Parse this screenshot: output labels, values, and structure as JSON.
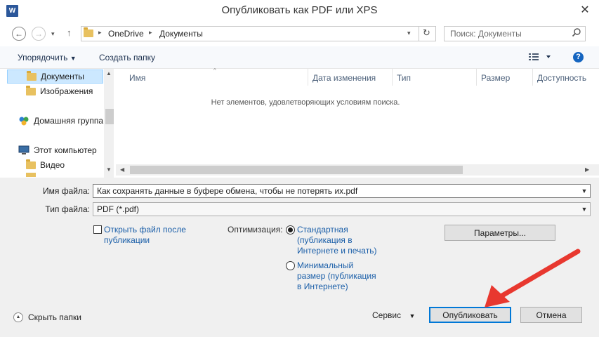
{
  "window": {
    "title": "Опубликовать как PDF или XPS",
    "app_icon_letter": "W",
    "close_symbol": "✕"
  },
  "address": {
    "path_root": "OneDrive",
    "path_folder": "Документы",
    "separator": "▸"
  },
  "search": {
    "placeholder": "Поиск: Документы"
  },
  "toolbar": {
    "organize_label": "Упорядочить",
    "new_folder_label": "Создать папку",
    "help_symbol": "?"
  },
  "sidebar": {
    "items": [
      {
        "label": "Документы"
      },
      {
        "label": "Изображения"
      },
      {
        "label": "Домашняя группа"
      },
      {
        "label": "Этот компьютер"
      },
      {
        "label": "Видео"
      }
    ]
  },
  "columns": [
    "Имя",
    "Дата изменения",
    "Тип",
    "Размер",
    "Доступность"
  ],
  "main": {
    "empty_message": "Нет элементов, удовлетворяющих условиям поиска."
  },
  "form": {
    "filename_label": "Имя файла:",
    "filename_value": "Как сохранять данные в буфере обмена, чтобы не потерять их.pdf",
    "filetype_label": "Тип файла:",
    "filetype_value": "PDF (*.pdf)",
    "open_after_line1": "Открыть файл после",
    "open_after_line2": "публикации",
    "optimize_label": "Оптимизация:",
    "standard_line1": "Стандартная",
    "standard_line2": "(публикация в",
    "standard_line3": "Интернете и печать)",
    "minimal_line1": "Минимальный",
    "minimal_line2": "размер (публикация",
    "minimal_line3": "в Интернете)",
    "params_button": "Параметры..."
  },
  "footer": {
    "hide_folders": "Скрыть папки",
    "service_label": "Сервис",
    "publish_button": "Опубликовать",
    "cancel_button": "Отмена"
  },
  "colors": {
    "accent": "#0078d7",
    "arrow": "#e8382f"
  }
}
